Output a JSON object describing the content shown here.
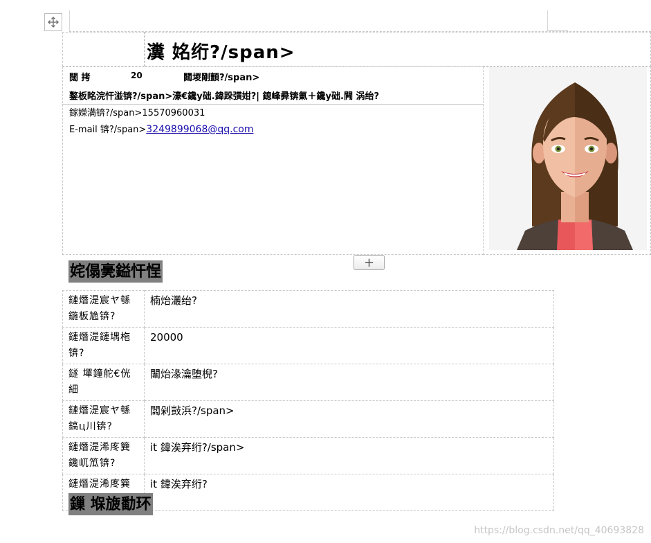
{
  "header": {
    "title": "瀵    姳绗?/span>"
  },
  "info": {
    "line1_label": "闊   拷",
    "line1_mid": "20",
    "line1_right": "閮堫剛顫?/span>",
    "line2": "鐜板眳浣忓湴锛?/span>濠€鑱у础.鍏跺彉姏?|  鎴峰彛锛氭＋鑱у础.闁    涡绐?",
    "phone": "鎵嬫満锛?/span>15570960031",
    "email_label": "E-mail 锛?/span>",
    "email_value": "3249899068@qq.com"
  },
  "sections": {
    "section1_heading": "姹傝亴鎰忓悜",
    "section2_heading": "鏁    堢旇勫环"
  },
  "table": {
    "rows": [
      {
        "label": "鏈熸湜宸ヤ綔鍦板尯锛?",
        "value": "楠炲灇绐?"
      },
      {
        "label": "鏈熸湜鏈堣柂锛?",
        "value": "20000"
      },
      {
        "label": "鐩    墠鐘舵€侊細",
        "value": "闈炲湪瀹堕棿?"
      },
      {
        "label": "鏈熸湜宸ヤ綔鎬ц川锛?",
        "value": "闆剁敱浜?/span>"
      },
      {
        "label": "鏈熸湜浠庝簨鑱屼笟锛?",
        "value": "it 鍏涘弃绗?/span>"
      },
      {
        "label": "鏈熸湜浠庝簨琛屼笟锛?",
        "value": "it 鍏涘弃绗?"
      }
    ]
  },
  "watermark": "https://blog.csdn.net/qq_40693828",
  "colors": {
    "section_bg": "#808080",
    "link": "#1a0dab",
    "grid": "#c8c8c8"
  }
}
